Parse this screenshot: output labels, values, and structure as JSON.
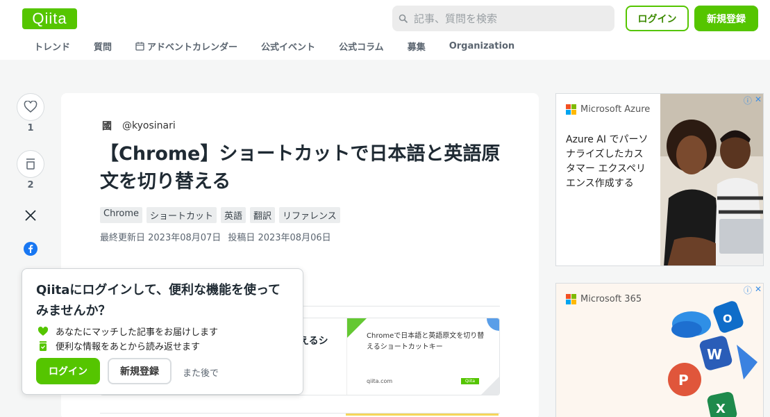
{
  "header": {
    "logo": "Qiita",
    "search_placeholder": "記事、質問を検索",
    "login_label": "ログイン",
    "signup_label": "新規登録"
  },
  "nav": {
    "items": [
      "トレンド",
      "質問",
      "アドベントカレンダー",
      "公式イベント",
      "公式コラム",
      "募集",
      "Organization"
    ]
  },
  "sidebar": {
    "like_count": "1",
    "stock_count": "2"
  },
  "article": {
    "author_avatar": "國",
    "author": "@kyosinari",
    "title": "【Chrome】ショートカットで日本語と英語原文を切り替える",
    "tags": [
      "Chrome",
      "ショートカット",
      "英語",
      "翻訳",
      "リファレンス"
    ],
    "updated": "最終更新日 2023年08月07日",
    "posted": "投稿日 2023年08月06日",
    "card": {
      "left_text": "えるシ",
      "image_title": "Chromeで日本語と英語原文を切り替えるショートカットキー",
      "image_site": "qiita.com",
      "image_brand": "Qiita"
    }
  },
  "ads": [
    {
      "brand": "Microsoft Azure",
      "text": "Azure AI でパーソ ナライズしたカス タマー エクスペリ エンス作成する",
      "colors": [
        "#f25022",
        "#7fba00",
        "#00a4ef",
        "#ffb900"
      ]
    },
    {
      "brand": "Microsoft 365"
    }
  ],
  "popup": {
    "title": "Qiitaにログインして、便利な機能を使ってみませんか？",
    "benefit1": "あなたにマッチした記事をお届けします",
    "benefit2": "便利な情報をあとから読み返せます",
    "login_label": "ログイン",
    "signup_label": "新規登録",
    "later_label": "また後で"
  },
  "colors": {
    "brand": "#55c500",
    "link": "#3a8ee6"
  }
}
